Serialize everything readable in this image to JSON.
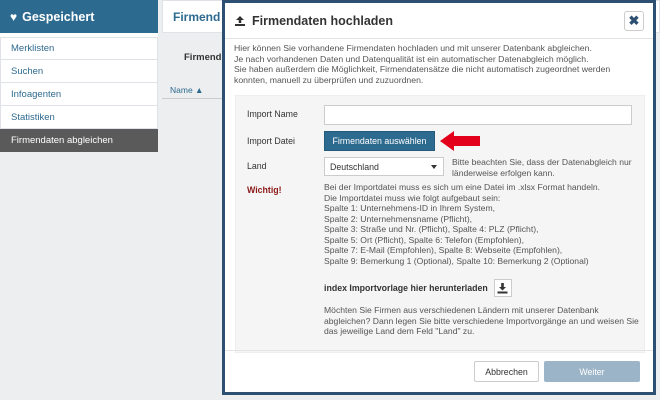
{
  "sidebar": {
    "title": "Gespeichert",
    "items": [
      {
        "label": "Merklisten"
      },
      {
        "label": "Suchen"
      },
      {
        "label": "Infoagenten"
      },
      {
        "label": "Statistiken"
      },
      {
        "label": "Firmendaten abgleichen"
      }
    ]
  },
  "background": {
    "title": "Firmend",
    "subtitle": "Firmend",
    "column": "Name ▲"
  },
  "modal": {
    "title": "Firmendaten hochladen",
    "intro_lines": [
      "Hier können Sie vorhandene Firmendaten hochladen und mit unserer Datenbank abgleichen.",
      "Je nach vorhandenen Daten und Datenqualität ist ein automatischer Datenabgleich möglich.",
      "Sie haben außerdem die Möglichkeit, Firmendatensätze die nicht automatisch zugeordnet werden konnten, manuell zu überprüfen und zuzuordnen."
    ],
    "import_name_label": "Import Name",
    "import_name_value": "",
    "import_file_label": "Import Datei",
    "import_file_button": "Firmendaten auswählen",
    "land_label": "Land",
    "land_value": "Deutschland",
    "land_note": "Bitte beachten Sie, dass der Datenabgleich nur länderweise erfolgen kann.",
    "warning_label": "Wichtig!",
    "warning_lines": [
      "Bei der Importdatei muss es sich um eine Datei im .xlsx Format handeln.",
      "Die Importdatei muss wie folgt aufgebaut sein:",
      "Spalte 1: Unternehmens-ID in Ihrem System,",
      "Spalte 2: Unternehmensname (Pflicht),",
      "Spalte 3: Straße und Nr. (Pflicht), Spalte 4: PLZ (Pflicht),",
      "Spalte 5: Ort (Pflicht), Spalte 6: Telefon (Empfohlen),",
      "Spalte 7: E-Mail (Empfohlen), Spalte 8: Webseite (Empfohlen),",
      "Spalte 9: Bemerkung 1 (Optional), Spalte 10: Bemerkung 2 (Optional)"
    ],
    "template_label": "index Importvorlage hier herunterladen",
    "multi_note": "Möchten Sie Firmen aus verschiedenen Ländern mit unserer Datenbank abgleichen? Dann legen Sie bitte verschiedene Importvorgänge an und weisen Sie das jeweilige Land dem Feld \"Land\" zu.",
    "cancel_button": "Abbrechen",
    "next_button": "Weiter",
    "close_symbol": "✖"
  },
  "colors": {
    "primary": "#2d6a8f",
    "modal_border": "#2d4f72",
    "arrow": "#e3001b",
    "warning": "#8c1a1a",
    "disabled_button": "#9cb4c7"
  },
  "icons": {
    "sidebar_header": "heart-icon",
    "modal_header": "upload-icon",
    "close": "close-icon",
    "download": "download-icon",
    "annotation": "red-arrow-icon"
  }
}
